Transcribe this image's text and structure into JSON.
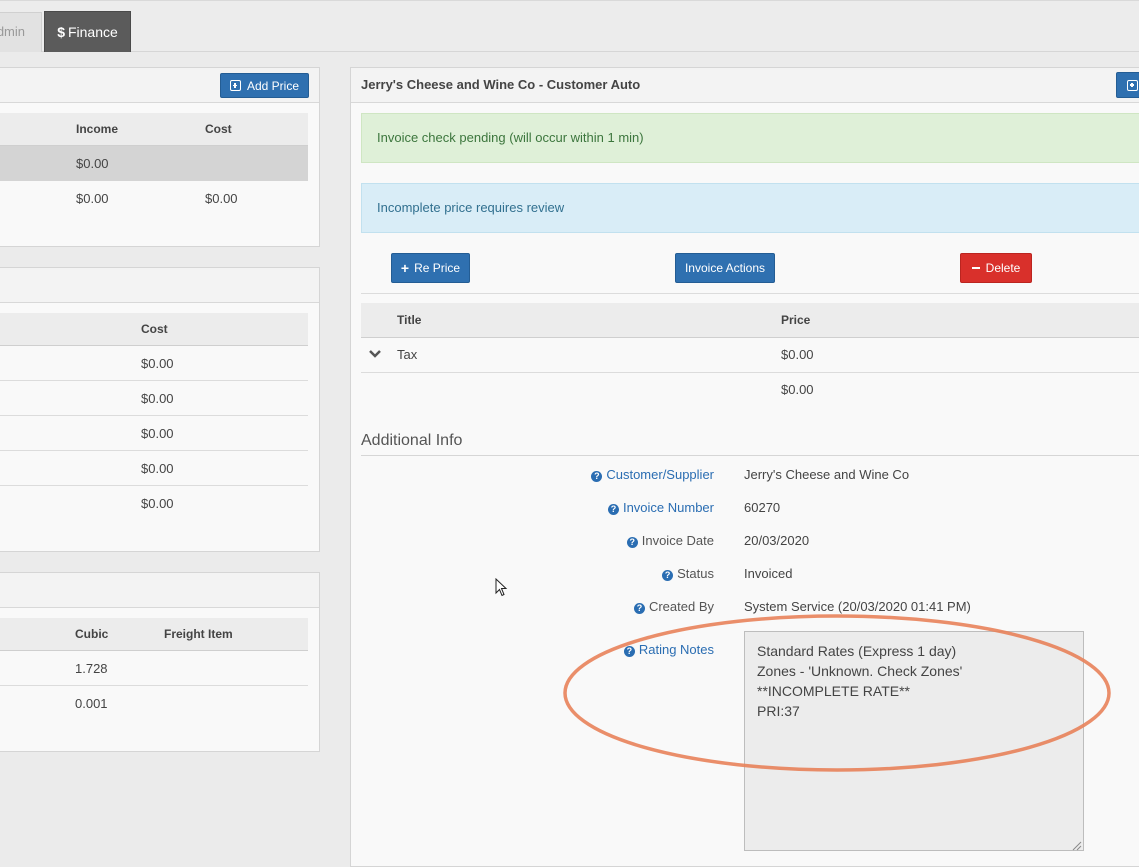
{
  "tabs": {
    "admin": "dmin",
    "finance": "Finance"
  },
  "left": {
    "panel1": {
      "add_price_label": "Add Price",
      "headers": {
        "income": "Income",
        "cost": "Cost"
      },
      "rows": [
        {
          "income": "$0.00",
          "cost": ""
        },
        {
          "income": "$0.00",
          "cost": "$0.00"
        }
      ]
    },
    "panel2": {
      "header_cost": "Cost",
      "rows": [
        "$0.00",
        "$0.00",
        "$0.00",
        "$0.00",
        "$0.00"
      ]
    },
    "panel3": {
      "headers": {
        "cubic": "Cubic",
        "freight": "Freight Item"
      },
      "rows": [
        {
          "cubic": "1.728"
        },
        {
          "cubic": "0.001"
        }
      ]
    }
  },
  "right": {
    "title": "Jerry's Cheese and Wine Co - Customer Auto",
    "alert_green": "Invoice check pending (will occur within 1 min)",
    "alert_blue": "Incomplete price requires review",
    "buttons": {
      "reprice": "Re Price",
      "invoice_actions": "Invoice Actions",
      "delete": "Delete"
    },
    "table": {
      "headers": {
        "title": "Title",
        "price": "Price"
      },
      "rows": [
        {
          "title": "Tax",
          "price": "$0.00"
        },
        {
          "title": "",
          "price": "$0.00"
        }
      ]
    },
    "additional_info": {
      "heading": "Additional Info",
      "fields": {
        "customer_label": "Customer/Supplier",
        "customer_value": "Jerry's Cheese and Wine Co",
        "invoice_number_label": "Invoice Number",
        "invoice_number_value": "60270",
        "invoice_date_label": "Invoice Date",
        "invoice_date_value": "20/03/2020",
        "status_label": "Status",
        "status_value": "Invoiced",
        "created_by_label": "Created By",
        "created_by_value": "System Service (20/03/2020 01:41 PM)",
        "rating_notes_label": "Rating Notes"
      },
      "rating_notes": "Standard Rates (Express 1 day)\nZones - 'Unknown. Check Zones'\n**INCOMPLETE RATE**\nPRI:37"
    }
  },
  "annotation": {
    "color": "#e8825a"
  },
  "icons": [
    "dollar-icon",
    "plus-square-icon",
    "plus-icon",
    "minus-icon",
    "chevron-down-icon",
    "question-circle-icon",
    "mouse-cursor-icon",
    "resize-handle-icon"
  ]
}
